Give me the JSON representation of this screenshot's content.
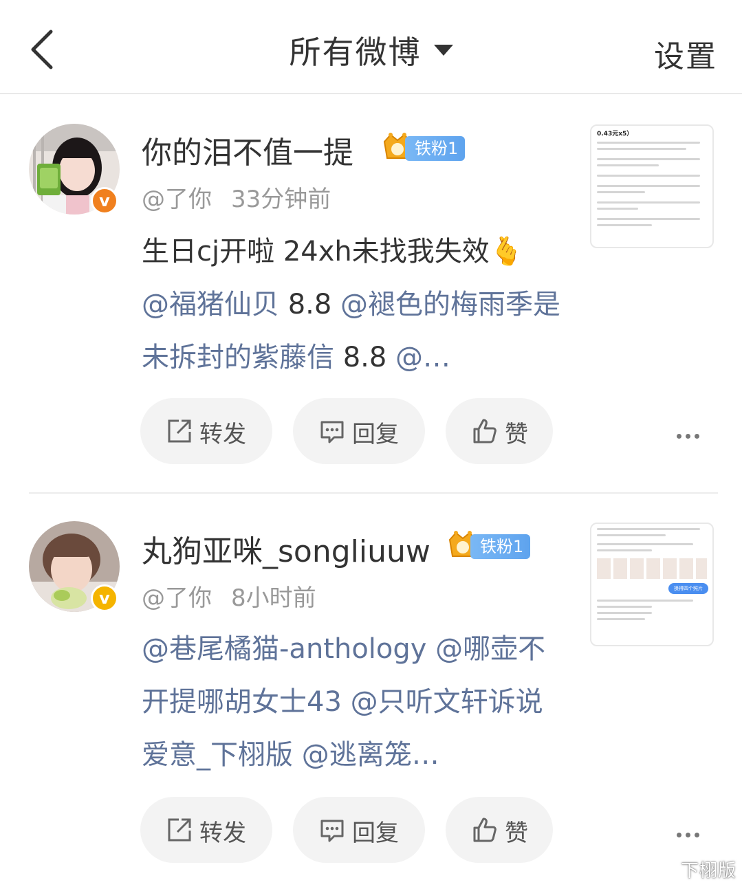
{
  "nav": {
    "title": "所有微博",
    "settings": "设置"
  },
  "posts": [
    {
      "username": "你的泪不值一提",
      "fan_badge": "铁粉1",
      "verified_color": "#f0801e",
      "verified_mark": "v",
      "at": "@了你",
      "time": "33分钟前",
      "text_plain": "生日cj开啦 24xh未找我失效🫰",
      "mention1": "@福猪仙贝",
      "value1": " 8.8 ",
      "mention2": "@褪色的梅雨季是未拆封的紫藤信",
      "value2": " 8.8 ",
      "mention3": "@…",
      "thumb_title": "0.43元x5）",
      "actions": {
        "repost": "转发",
        "reply": "回复",
        "like": "赞"
      }
    },
    {
      "username": "丸狗亚咪_songliuuw",
      "fan_badge": "铁粉1",
      "verified_color": "#f5b400",
      "verified_mark": "v",
      "at": "@了你",
      "time": "8小时前",
      "mention1": "@巷尾橘猫-anthology",
      "sep1": " ",
      "mention2": "@哪壶不开提哪胡女士43",
      "sep2": " ",
      "mention3": "@只听文轩诉说爱意_下栩版",
      "sep3": " ",
      "mention4": "@逃离笼…",
      "thumb_button": "换得四个照片",
      "actions": {
        "repost": "转发",
        "reply": "回复",
        "like": "赞"
      }
    }
  ],
  "watermark": "下栩版"
}
